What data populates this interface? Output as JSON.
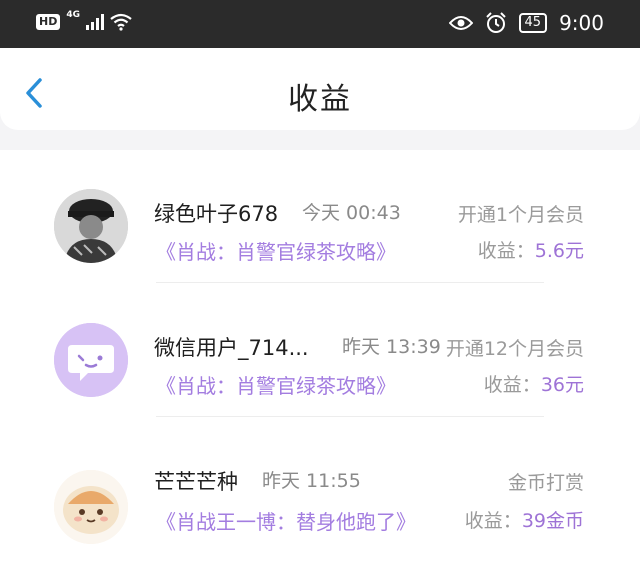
{
  "status_bar": {
    "hd": "HD",
    "network": "4G",
    "battery": "45",
    "time": "9:00"
  },
  "header": {
    "title": "收益"
  },
  "records": [
    {
      "name": "绿色叶子678",
      "time": "今天 00:43",
      "type": "开通1个月会员",
      "book": "《肖战：肖警官绿茶攻略》",
      "earn_label": "收益：",
      "earn_amount": "5.6元"
    },
    {
      "name": "微信用户_714...",
      "time": "昨天 13:39",
      "type": "开通12个月会员",
      "book": "《肖战：肖警官绿茶攻略》",
      "earn_label": "收益：",
      "earn_amount": "36元"
    },
    {
      "name": "芒芒芒种",
      "time": "昨天 11:55",
      "type": "金币打赏",
      "book": "《肖战王一博：替身他跑了》",
      "earn_label": "收益：",
      "earn_amount": "39金币"
    }
  ],
  "colors": {
    "accent_back": "#2a8fd8",
    "book_purple": "#a37de0",
    "amount_purple": "#9e73d6",
    "avatar_wechat_bg": "#d7c2f5"
  },
  "icons": [
    "back-arrow-icon",
    "eye-icon",
    "alarm-icon",
    "wifi-icon",
    "signal-icon",
    "battery-icon",
    "wechat-bubble-icon"
  ]
}
